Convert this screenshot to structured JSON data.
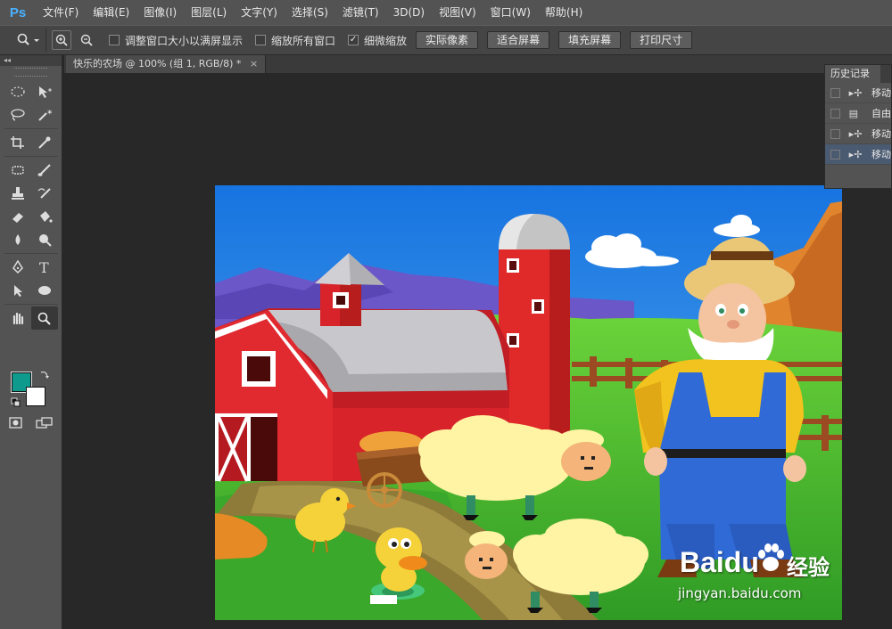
{
  "app": {
    "logo": "Ps"
  },
  "menu": [
    {
      "label": "文件(F)"
    },
    {
      "label": "编辑(E)"
    },
    {
      "label": "图像(I)"
    },
    {
      "label": "图层(L)"
    },
    {
      "label": "文字(Y)"
    },
    {
      "label": "选择(S)"
    },
    {
      "label": "滤镜(T)"
    },
    {
      "label": "3D(D)"
    },
    {
      "label": "视图(V)"
    },
    {
      "label": "窗口(W)"
    },
    {
      "label": "帮助(H)"
    }
  ],
  "options": {
    "tool_icon": "zoom-tool-icon",
    "checkboxes": [
      {
        "label": "调整窗口大小以满屏显示",
        "checked": false
      },
      {
        "label": "缩放所有窗口",
        "checked": false
      },
      {
        "label": "细微缩放",
        "checked": true
      }
    ],
    "buttons": [
      {
        "label": "实际像素"
      },
      {
        "label": "适合屏幕"
      },
      {
        "label": "填充屏幕"
      },
      {
        "label": "打印尺寸"
      }
    ]
  },
  "document": {
    "tab_title": "快乐的农场 @ 100% (组 1, RGB/8) *",
    "close_glyph": "×"
  },
  "history": {
    "title": "历史记录",
    "items": [
      {
        "label": "移动",
        "icon": "move-tool-icon",
        "selected": false
      },
      {
        "label": "自由",
        "icon": "document-icon",
        "selected": false
      },
      {
        "label": "移动",
        "icon": "move-tool-icon",
        "selected": false
      },
      {
        "label": "移动",
        "icon": "move-tool-icon",
        "selected": true
      }
    ]
  },
  "colors": {
    "foreground": "#0f9a8e",
    "background": "#ffffff",
    "accent": "#4ab0ff"
  },
  "watermark": {
    "brand": "Baidu",
    "cn": "经验",
    "url": "jingyan.baidu.com"
  }
}
